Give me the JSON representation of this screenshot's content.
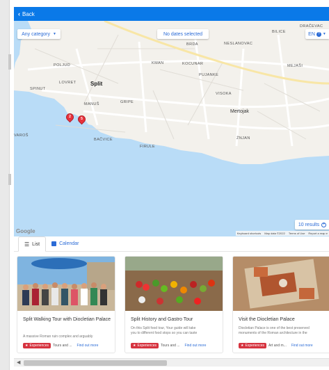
{
  "topbar": {
    "back_label": "Back"
  },
  "map": {
    "category_filter": "Any category",
    "date_filter": "No dates selected",
    "language": "EN",
    "results_label": "10 results",
    "google_logo": "Google",
    "attribution": [
      "Keyboard shortcuts",
      "Map data ©2022",
      "Terms of Use",
      "Report a map e"
    ],
    "places": {
      "brda": "BRDA",
      "neslanovac": "NESLANOVAC",
      "bilice": "BILICE",
      "dracevac": "DRAČEVAC",
      "poljud": "POLJUD",
      "kman": "KMAN",
      "kocunar": "KOCUNAR",
      "mejasi": "MEJAŠI",
      "lovret": "LOVRET",
      "pujanke": "PUJANKE",
      "spinut": "SPINUT",
      "split": "Split",
      "visoka": "VISOKA",
      "manus": "MANUŠ",
      "gripe": "GRIPE",
      "mertojak": "Mertojak",
      "varos": "VAROŠ",
      "bacvice": "BAČVICE",
      "znjan": "ŽNJAN",
      "firule": "FIRULE"
    },
    "pins": [
      "2",
      "5"
    ]
  },
  "tabs": [
    {
      "label": "List"
    },
    {
      "label": "Calendar"
    }
  ],
  "cards": [
    {
      "title": "Split Walking Tour with Diocletian Palace",
      "desc": [
        "A massive Roman ruin complex and arguably"
      ],
      "badge": "Experiences",
      "tags": "Tours and ...",
      "link": "Find out more"
    },
    {
      "title": "Split History and Gastro Tour",
      "desc": [
        "On this Split food tour, Your guide will take",
        "you to different food stops so you can taste"
      ],
      "badge": "Experiences",
      "tags": "Tours and ...",
      "link": "Find out more"
    },
    {
      "title": "Visit the Diocletian Palace",
      "desc": [
        "Diocletian Palace is one of the best preserved",
        "monuments of the Roman architecture in the"
      ],
      "badge": "Experiences",
      "tags": "Art and m...",
      "link": "Find out more"
    }
  ],
  "colors": {
    "topbar": "#0a79e8",
    "link": "#2b6bd6",
    "badge": "#d6333f",
    "sea": "#b9dcf7",
    "land": "#f3f1ec"
  }
}
